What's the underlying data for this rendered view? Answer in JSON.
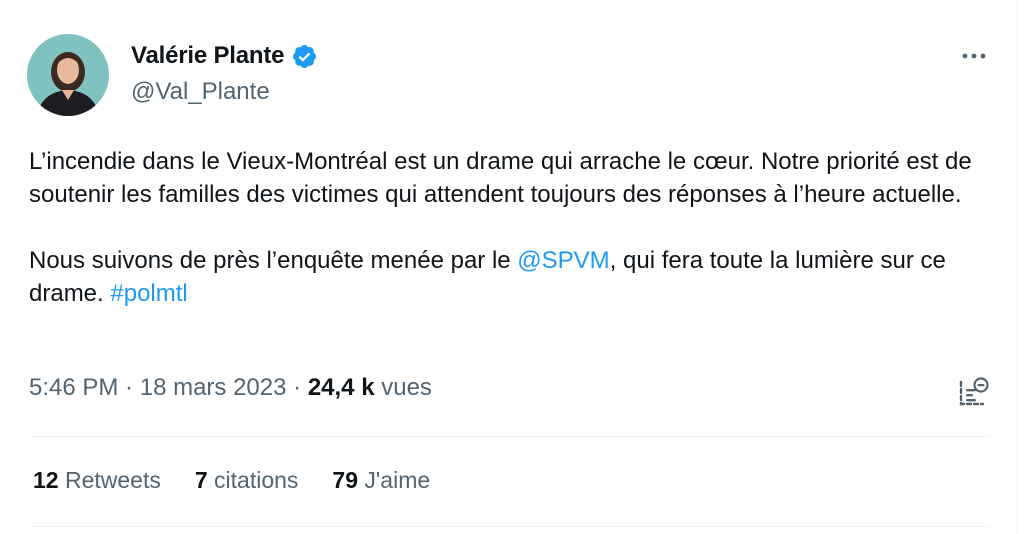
{
  "author": {
    "name": "Valérie Plante",
    "handle": "@Val_Plante",
    "verified": true
  },
  "tweet": {
    "paragraph1": "L’incendie dans le Vieux-Montréal est un drame qui arrache le cœur. Notre priorité est de soutenir les familles des victimes qui attendent toujours des réponses à l’heure actuelle.",
    "paragraph2_before_mention": "Nous suivons de près l’enquête menée par le ",
    "mention": "@SPVM",
    "paragraph2_after_mention": ", qui fera toute la lumière sur ce drame. ",
    "hashtag": "#polmtl"
  },
  "meta": {
    "time": "5:46 PM",
    "sep1": " · ",
    "date": "18 mars 2023",
    "sep2": " · ",
    "views_count": "24,4 k",
    "views_label": " vues"
  },
  "stats": {
    "retweets_count": "12",
    "retweets_label": " Retweets",
    "quotes_count": "7",
    "quotes_label": " citations",
    "likes_count": "79",
    "likes_label": " J'aime"
  },
  "colors": {
    "link": "#1d9bf0",
    "verified_badge": "#1d9bf0",
    "secondary_text": "#536471",
    "primary_text": "#0f1419"
  },
  "icons": {
    "more": "more-icon",
    "verified": "verified-badge-icon",
    "analytics": "analytics-icon"
  }
}
